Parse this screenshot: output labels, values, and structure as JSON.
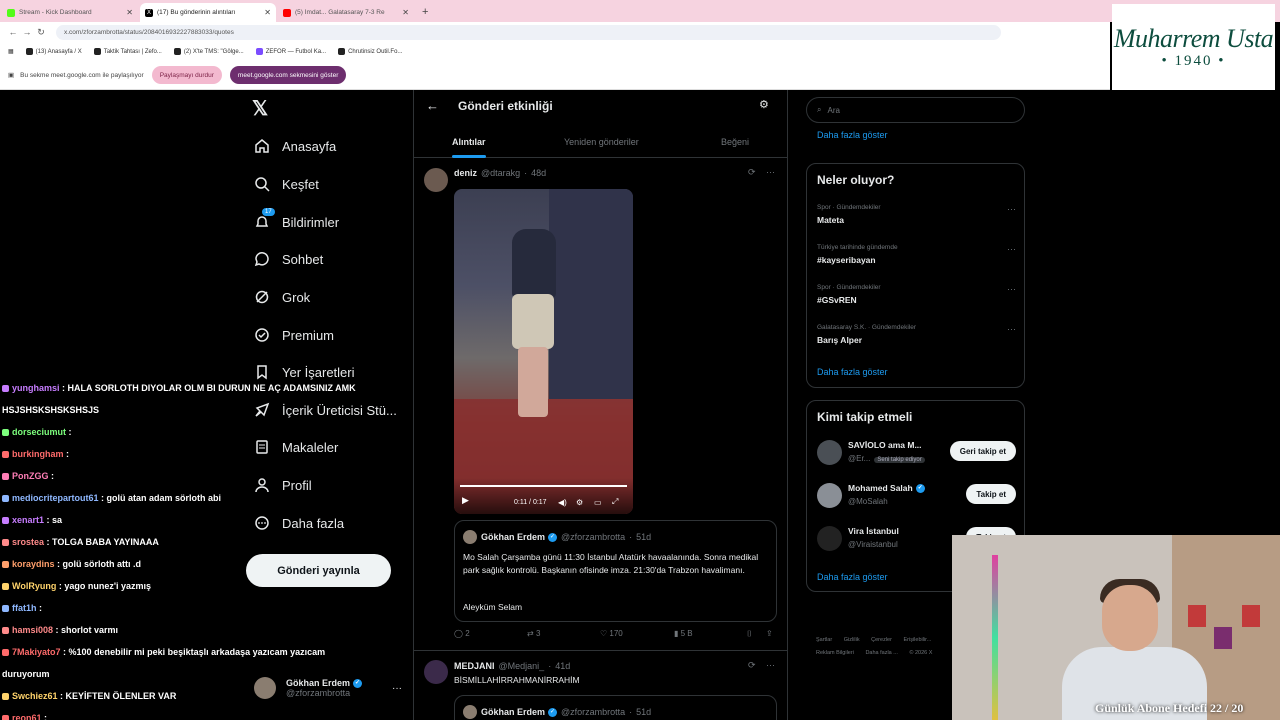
{
  "browser": {
    "tabs": [
      {
        "title": "Stream - Kick Dashboard",
        "active": false
      },
      {
        "title": "(17) Bu gönderinin alıntıları",
        "active": true
      },
      {
        "title": "(5) İmdat... Galatasaray 7-3 Re",
        "active": false
      }
    ],
    "new_tab": "+",
    "url": "x.com/zforzambrotta/status/2084016932227883033/quotes",
    "bookmarks": [
      "(13) Anasayfa / X",
      "Taktik Tahtası | Zefo...",
      "(2) X'te TMS: \"Gölge...",
      "ZEFOR — Futbol Ka...",
      "Chrutinsiz Outil.Fo..."
    ],
    "share_notice": "Bu sekme meet.google.com ile paylaşılıyor",
    "stop_sharing": "Paylaşmayı durdur",
    "show_meet_tab": "meet.google.com sekmesini göster"
  },
  "logo": {
    "name": "Muharrem Usta",
    "year": "• 1940 •"
  },
  "nav": {
    "items": [
      {
        "label": "Anasayfa",
        "icon": "home-icon"
      },
      {
        "label": "Keşfet",
        "icon": "search-icon"
      },
      {
        "label": "Bildirimler",
        "icon": "bell-icon",
        "badge": "17"
      },
      {
        "label": "Sohbet",
        "icon": "chat-icon"
      },
      {
        "label": "Grok",
        "icon": "grok-icon"
      },
      {
        "label": "Premium",
        "icon": "premium-icon"
      },
      {
        "label": "Yer İşaretleri",
        "icon": "bookmark-icon"
      },
      {
        "label": "İçerik Üreticisi Stü...",
        "icon": "creator-icon"
      },
      {
        "label": "Makaleler",
        "icon": "article-icon"
      },
      {
        "label": "Profil",
        "icon": "profile-icon"
      },
      {
        "label": "Daha fazla",
        "icon": "more-icon"
      }
    ],
    "post_button": "Gönderi yayınla",
    "account": {
      "name": "Gökhan Erdem",
      "handle": "@zforzambrotta"
    }
  },
  "chat": [
    {
      "user": "yunghamsi",
      "text": ": HALA SORLOTH DIYOLAR OLM BI DURUN NE AÇ ADAMSINIZ AMK",
      "color": "#c77dff"
    },
    {
      "user": "",
      "text": "HSJSHSKSHSKSHSJS",
      "color": "#ffffff"
    },
    {
      "user": "dorseciumut",
      "text": ":",
      "color": "#7dff7d"
    },
    {
      "user": "burkingham",
      "text": ":",
      "color": "#ff6b6b"
    },
    {
      "user": "PonZGG",
      "text": ":",
      "color": "#ff7eb6"
    },
    {
      "user": "mediocritepartout61",
      "text": ": golü atan adam sörloth abi",
      "color": "#8fb8ff"
    },
    {
      "user": "xenart1",
      "text": ": sa",
      "color": "#c77dff"
    },
    {
      "user": "srostea",
      "text": ": TOLGA BABA YAYINAAA",
      "color": "#ff8a8a"
    },
    {
      "user": "koraydins",
      "text": ": golü sörloth attı .d",
      "color": "#ff9f6b"
    },
    {
      "user": "WolRyung",
      "text": ": yago nunez'i yazmış",
      "color": "#ffd36b"
    },
    {
      "user": "ffat1h",
      "text": ":",
      "color": "#8fb8ff"
    },
    {
      "user": "hamsi008",
      "text": ": shorlot varmı",
      "color": "#ff8a8a"
    },
    {
      "user": "7Makiyato7",
      "text": ": %100 denebilir mi peki beşiktaşlı arkadaşa yazıcam yazıcam",
      "color": "#ff6b6b"
    },
    {
      "user": "",
      "text": "duruyorum",
      "color": "#ffffff"
    },
    {
      "user": "Swchiez61",
      "text": ": KEYİFTEN ÖLENLER VAR",
      "color": "#ffd36b"
    },
    {
      "user": "reon61",
      "text": ":",
      "color": "#ff6b6b"
    }
  ],
  "center": {
    "title": "Gönderi etkinliği",
    "tabs": [
      "Alıntılar",
      "Yeniden gönderiler",
      "Beğeni"
    ],
    "post1": {
      "name": "deniz",
      "handle": "@dtarakg",
      "age": "48d",
      "video_time": "0:11 / 0:17",
      "quote": {
        "name": "Gökhan Erdem",
        "handle": "@zforzambrotta",
        "age": "51d",
        "text": "Mo Salah Çarşamba günü 11:30 İstanbul Atatürk havaalanında. Sonra medikal park sağlık kontrolü. Başkanın ofisinde imza. 21:30'da Trabzon havalimanı.",
        "sign": "Aleyküm Selam"
      },
      "actions": {
        "replies": "2",
        "reposts": "3",
        "likes": "170",
        "views": "5 B"
      }
    },
    "post2": {
      "name": "MEDJANI",
      "handle": "@Medjani_",
      "age": "41d",
      "text": "BİSMİLLAHİRRAHMANİRRAHİM",
      "quote": {
        "name": "Gökhan Erdem",
        "handle": "@zforzambrotta",
        "age": "51d"
      }
    }
  },
  "right": {
    "search_placeholder": "Ara",
    "show_more": "Daha fazla göster",
    "trends_title": "Neler oluyor?",
    "trends": [
      {
        "category": "Spor · Gündemdekiler",
        "topic": "Mateta"
      },
      {
        "category": "Türkiye tarihinde gündemde",
        "topic": "#kayseribayan"
      },
      {
        "category": "Spor · Gündemdekiler",
        "topic": "#GSvREN"
      },
      {
        "category": "Galatasaray S.K. · Gündemdekiler",
        "topic": "Barış Alper"
      }
    ],
    "follow_title": "Kimi takip etmeli",
    "follows": [
      {
        "name": "SAVİOLO ama M...",
        "handle": "@Er...",
        "tag": "Seni takip ediyor",
        "button": "Geri takip et"
      },
      {
        "name": "Mohamed Salah",
        "handle": "@MoSalah",
        "tag": "",
        "button": "Takip et"
      },
      {
        "name": "Vira İstanbul",
        "handle": "@Viraistanbul",
        "tag": "",
        "button": "Takip et"
      }
    ],
    "footer": [
      "Şartlar",
      "Gizlilik",
      "Çerezler",
      "Erişilebilir...",
      "Reklam Bilgileri",
      "Daha fazla ...",
      "© 2026 X"
    ]
  },
  "webcam": {
    "goal_text": "Günlük Abone Hedefi 22 / 20"
  }
}
